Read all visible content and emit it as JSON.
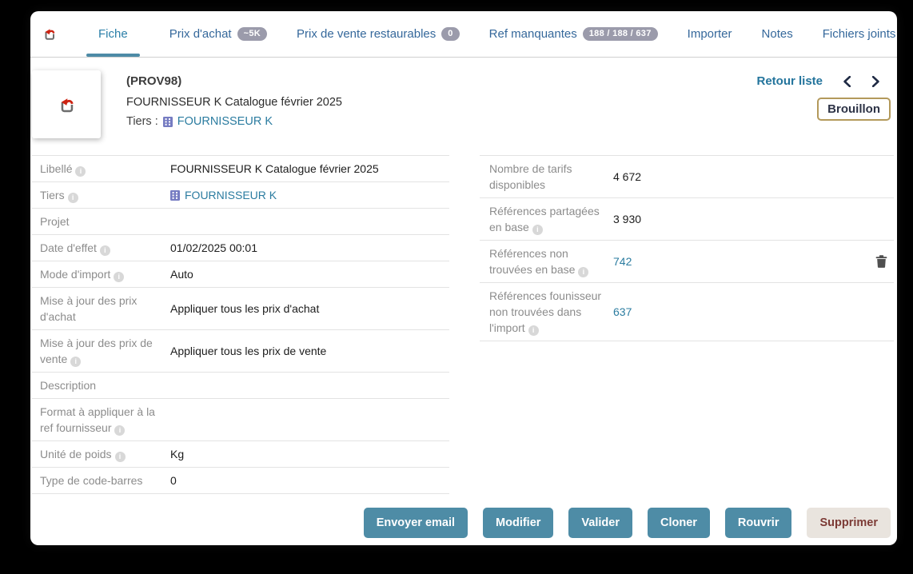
{
  "colors": {
    "accent_teal": "#4e8ca6",
    "tab_text": "#35689b",
    "link": "#2b7ca0",
    "badge_gray": "#9b9bab",
    "draft_border": "#b3995b",
    "delete_text": "#7c3a35",
    "delete_bg": "#e9e4de"
  },
  "icons": {
    "back": "red-curved-arrow-on-gray-box",
    "company": "purple-building",
    "trash": "dark-gray-trash-can",
    "info": "gray-circle-i"
  },
  "tabs": {
    "items": [
      {
        "label": "Fiche",
        "active": true
      },
      {
        "label": "Prix d'achat",
        "badge": "~5K"
      },
      {
        "label": "Prix de vente restaurables",
        "badge": "0"
      },
      {
        "label": "Ref manquantes",
        "badge": "188 / 188 / 637"
      },
      {
        "label": "Importer"
      },
      {
        "label": "Notes"
      },
      {
        "label": "Fichiers joints"
      }
    ]
  },
  "header": {
    "ref": "(PROV98)",
    "title": "FOURNISSEUR K Catalogue février 2025",
    "tiers_label": "Tiers :",
    "tiers_value": "FOURNISSEUR K",
    "back_to_list": "Retour liste",
    "status": "Brouillon"
  },
  "left_table": {
    "rows": [
      {
        "label": "Libellé",
        "info": true,
        "value": "FOURNISSEUR K Catalogue février 2025"
      },
      {
        "label": "Tiers",
        "info": true,
        "value": "FOURNISSEUR K",
        "tiers": true,
        "link": true
      },
      {
        "label": "Projet",
        "value": ""
      },
      {
        "label": "Date d'effet",
        "info": true,
        "value": "01/02/2025 00:01"
      },
      {
        "label": "Mode d'import",
        "info": true,
        "value": "Auto"
      },
      {
        "label": "Mise à jour des prix d'achat",
        "value": "Appliquer tous les prix d'achat"
      },
      {
        "label": "Mise à jour des prix de vente",
        "info": true,
        "value": "Appliquer tous les prix de vente"
      },
      {
        "label": "Description",
        "value": ""
      },
      {
        "label": "Format à appliquer à la ref fournisseur",
        "info": true,
        "value": ""
      },
      {
        "label": "Unité de poids",
        "info": true,
        "value": "Kg"
      },
      {
        "label": "Type de code-barres",
        "value": "0"
      }
    ]
  },
  "right_table": {
    "rows": [
      {
        "label": "Nombre de tarifs disponibles",
        "value": "4 672"
      },
      {
        "label": "Références partagées en base",
        "info": true,
        "value": "3 930"
      },
      {
        "label": "Références non trouvées en base",
        "info": true,
        "value": "742",
        "link": true,
        "trash": true
      },
      {
        "label": "Références founisseur non trouvées dans l'import",
        "info": true,
        "value": "637",
        "link": true
      }
    ]
  },
  "actions": {
    "buttons": [
      {
        "label": "Envoyer email",
        "style": "primary"
      },
      {
        "label": "Modifier",
        "style": "primary"
      },
      {
        "label": "Valider",
        "style": "primary"
      },
      {
        "label": "Cloner",
        "style": "primary"
      },
      {
        "label": "Rouvrir",
        "style": "primary"
      },
      {
        "label": "Supprimer",
        "style": "delete"
      }
    ]
  }
}
